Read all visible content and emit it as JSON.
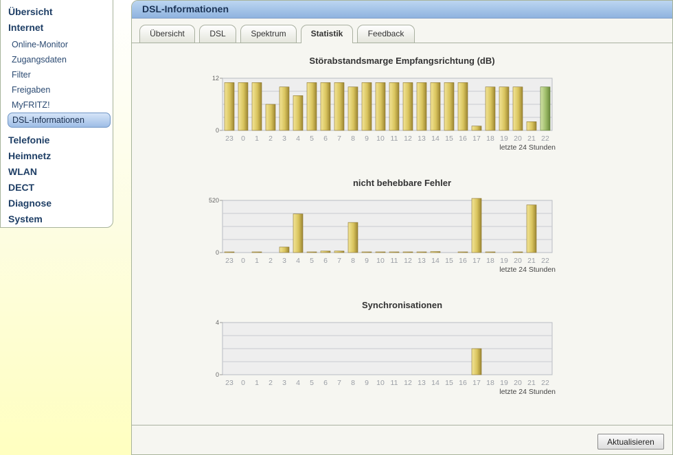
{
  "sidebar": {
    "items": [
      {
        "label": "Übersicht",
        "level": 1
      },
      {
        "label": "Internet",
        "level": 1
      },
      {
        "label": "Online-Monitor",
        "level": 2
      },
      {
        "label": "Zugangsdaten",
        "level": 2
      },
      {
        "label": "Filter",
        "level": 2
      },
      {
        "label": "Freigaben",
        "level": 2
      },
      {
        "label": "MyFRITZ!",
        "level": 2
      },
      {
        "label": "DSL-Informationen",
        "level": 2,
        "active": true
      },
      {
        "label": "Telefonie",
        "level": 1
      },
      {
        "label": "Heimnetz",
        "level": 1
      },
      {
        "label": "WLAN",
        "level": 1
      },
      {
        "label": "DECT",
        "level": 1
      },
      {
        "label": "Diagnose",
        "level": 1
      },
      {
        "label": "System",
        "level": 1
      }
    ]
  },
  "panel": {
    "title": "DSL-Informationen",
    "tabs": [
      {
        "label": "Übersicht"
      },
      {
        "label": "DSL"
      },
      {
        "label": "Spektrum"
      },
      {
        "label": "Statistik",
        "active": true
      },
      {
        "label": "Feedback"
      }
    ],
    "refresh_label": "Aktualisieren"
  },
  "colors": {
    "bar_gold": "#d9c45e",
    "bar_green": "#9fbd6a",
    "plot_bg": "#eeeeee",
    "grid": "#c8cbd0"
  },
  "chart_data": [
    {
      "type": "bar",
      "title": "Störabstandsmarge Empfangsrichtung (dB)",
      "categories": [
        "23",
        "0",
        "1",
        "2",
        "3",
        "4",
        "5",
        "6",
        "7",
        "8",
        "9",
        "10",
        "11",
        "12",
        "13",
        "14",
        "15",
        "16",
        "17",
        "18",
        "19",
        "20",
        "21",
        "22"
      ],
      "values": [
        11,
        11,
        11,
        6,
        10,
        8,
        11,
        11,
        11,
        10,
        11,
        11,
        11,
        11,
        11,
        11,
        11,
        11,
        1,
        10,
        10,
        10,
        2,
        10
      ],
      "highlight_index": 23,
      "ylim": [
        0,
        12
      ],
      "ytick_labels": [
        "0",
        "12"
      ],
      "footnote": "letzte 24 Stunden"
    },
    {
      "type": "bar",
      "title": "nicht behebbare Fehler",
      "categories": [
        "23",
        "0",
        "1",
        "2",
        "3",
        "4",
        "5",
        "6",
        "7",
        "8",
        "9",
        "10",
        "11",
        "12",
        "13",
        "14",
        "15",
        "16",
        "17",
        "18",
        "19",
        "20",
        "21",
        "22"
      ],
      "values": [
        5,
        0,
        5,
        0,
        55,
        385,
        5,
        15,
        15,
        300,
        5,
        5,
        5,
        5,
        5,
        10,
        0,
        5,
        540,
        5,
        0,
        5,
        475,
        0
      ],
      "ylim": [
        0,
        520
      ],
      "ytick_labels": [
        "0",
        "520"
      ],
      "footnote": "letzte 24 Stunden"
    },
    {
      "type": "bar",
      "title": "Synchronisationen",
      "categories": [
        "23",
        "0",
        "1",
        "2",
        "3",
        "4",
        "5",
        "6",
        "7",
        "8",
        "9",
        "10",
        "11",
        "12",
        "13",
        "14",
        "15",
        "16",
        "17",
        "18",
        "19",
        "20",
        "21",
        "22"
      ],
      "values": [
        0,
        0,
        0,
        0,
        0,
        0,
        0,
        0,
        0,
        0,
        0,
        0,
        0,
        0,
        0,
        0,
        0,
        0,
        2,
        0,
        0,
        0,
        0,
        0
      ],
      "ylim": [
        0,
        4
      ],
      "ytick_labels": [
        "0",
        "4"
      ],
      "footnote": "letzte 24 Stunden"
    }
  ]
}
